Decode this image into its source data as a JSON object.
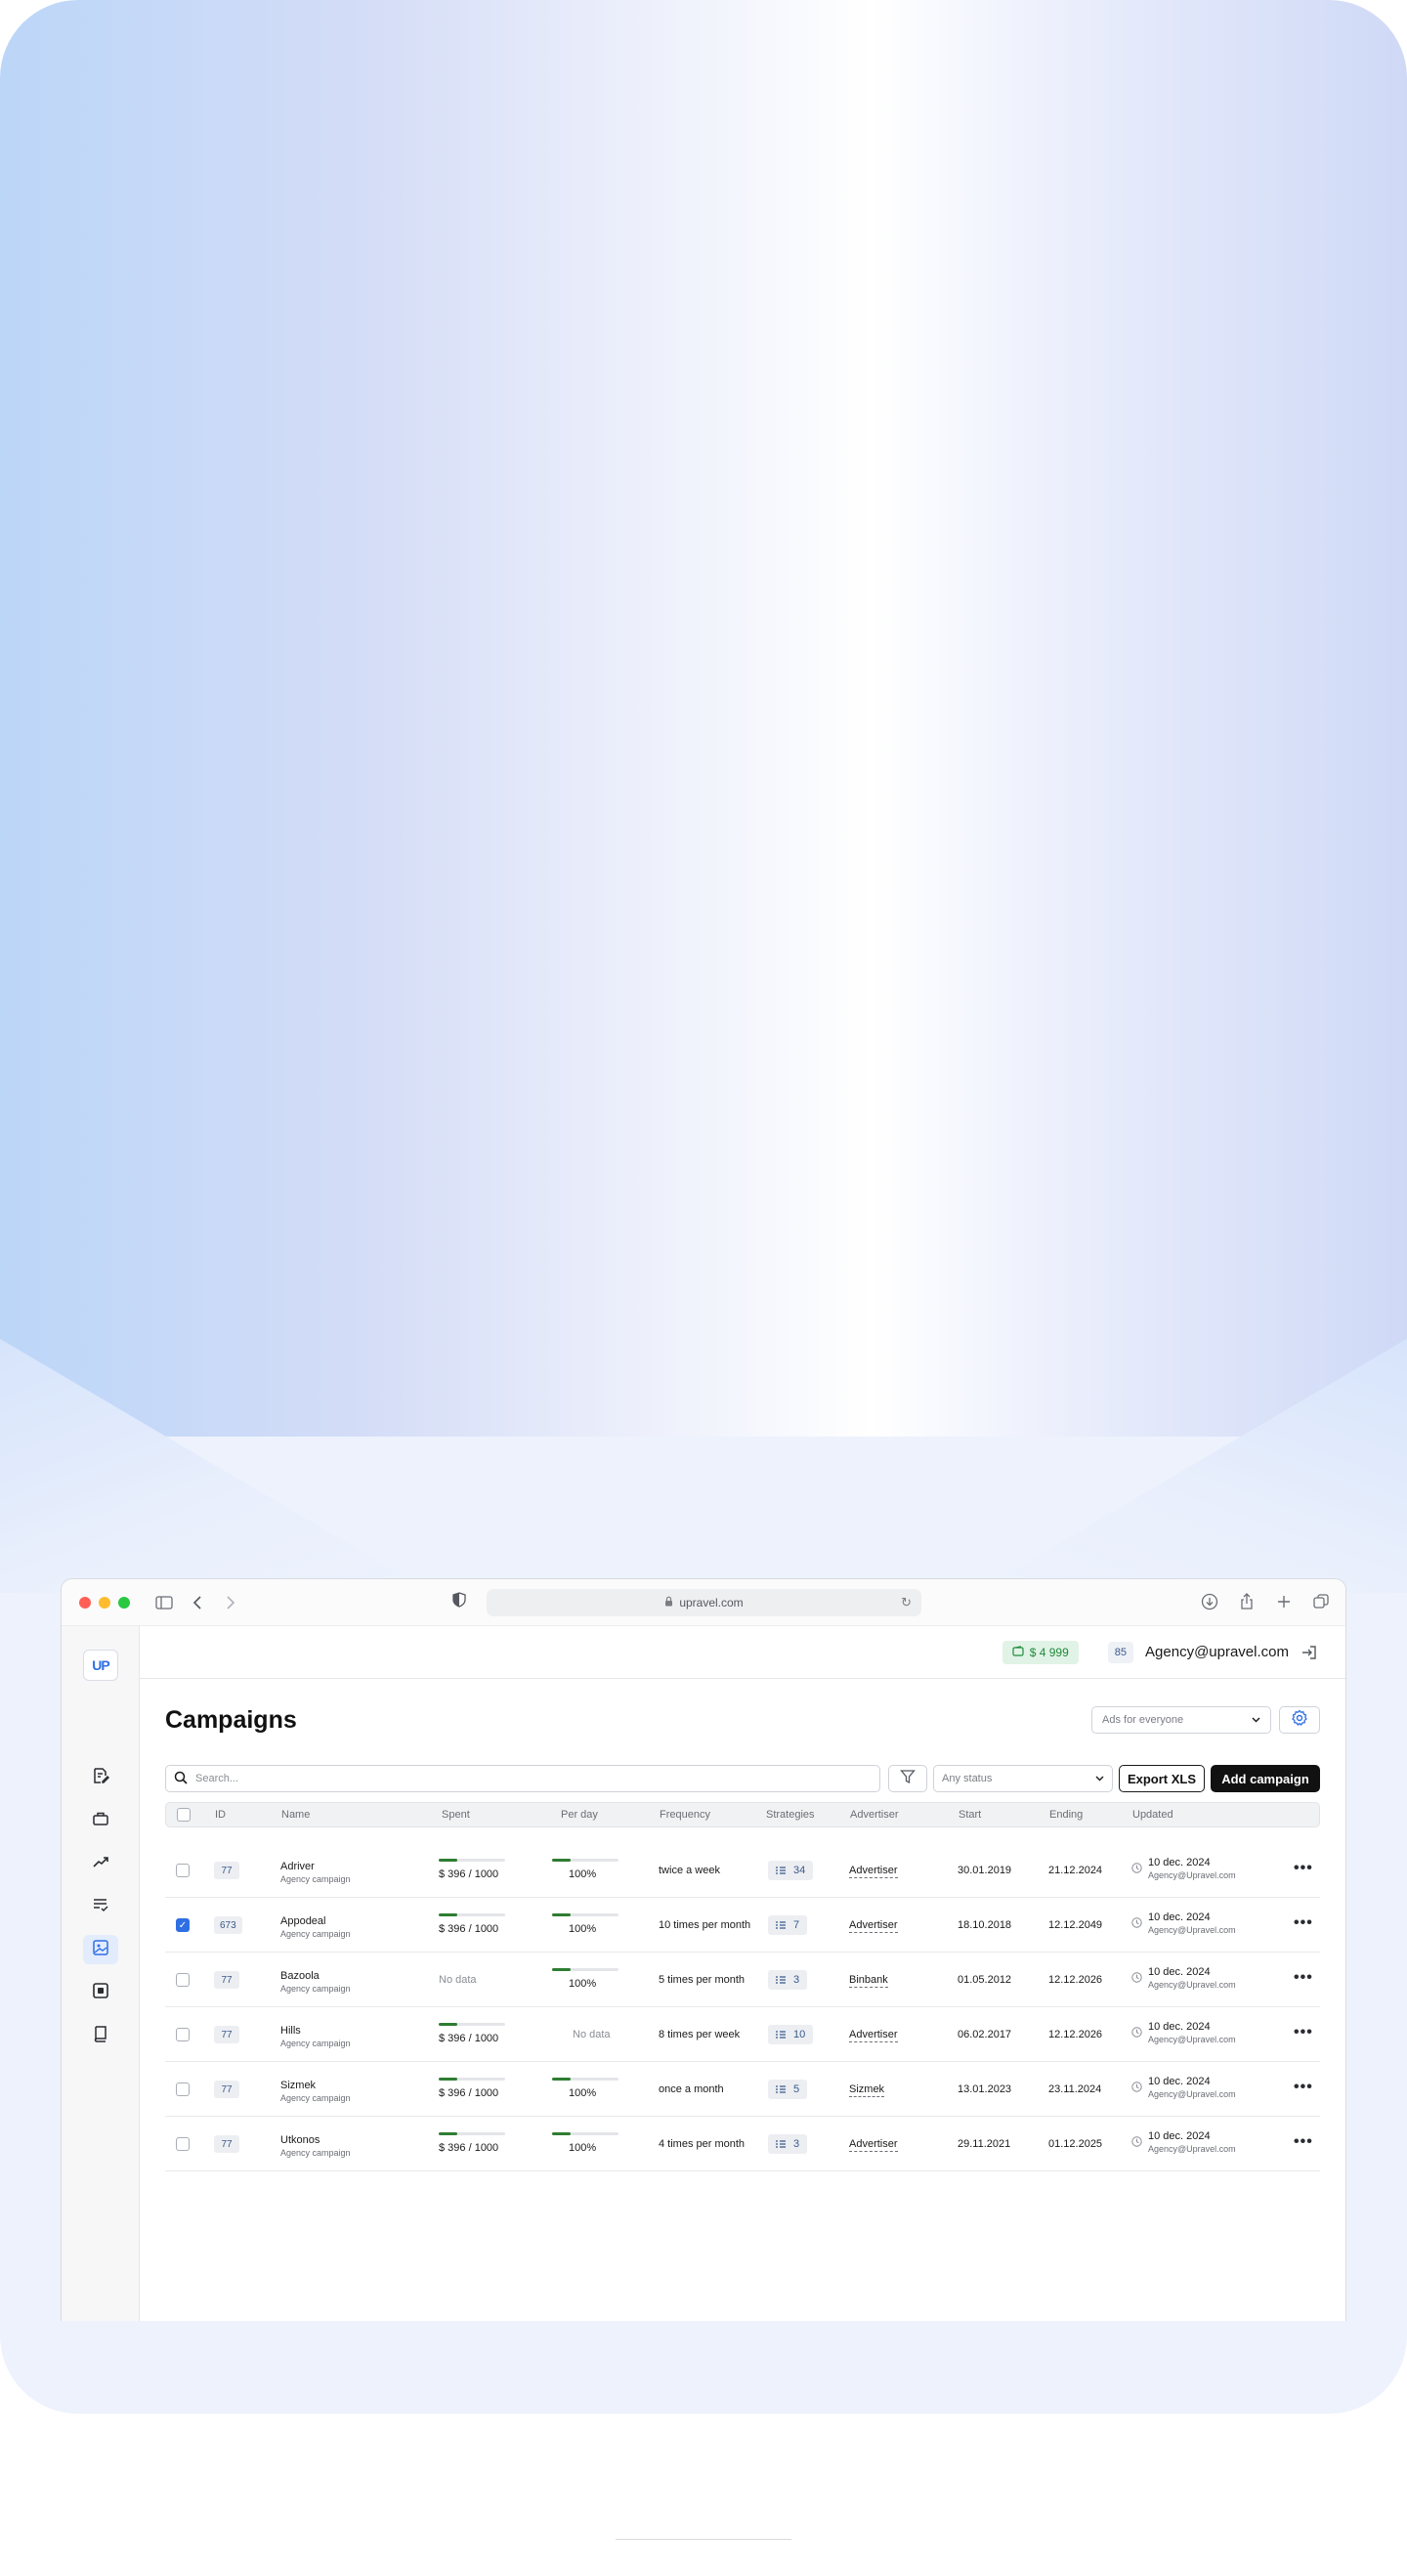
{
  "browser": {
    "url": "upravel.com"
  },
  "sidebar": {
    "logo_text": "UP",
    "items": [
      {
        "icon": "document-icon"
      },
      {
        "icon": "briefcase-icon"
      },
      {
        "icon": "trending-icon"
      },
      {
        "icon": "list-check-icon"
      },
      {
        "icon": "image-icon",
        "active": true
      },
      {
        "icon": "square-icon"
      },
      {
        "icon": "book-icon"
      }
    ]
  },
  "topbar": {
    "balance": "$ 4 999",
    "notifications": "85",
    "account": "Agency@upravel.com"
  },
  "page": {
    "title": "Campaigns",
    "ads_select": "Ads for everyone",
    "search_placeholder": "Search...",
    "status_select": "Any status",
    "export_label": "Export XLS",
    "add_label": "Add campaign"
  },
  "table": {
    "columns": [
      "ID",
      "Name",
      "Spent",
      "Per day",
      "Frequency",
      "Strategies",
      "Advertiser",
      "Start",
      "Ending",
      "Updated"
    ],
    "rows": [
      {
        "checked": false,
        "id": "77",
        "name": "Adriver",
        "sub": "Agency campaign",
        "spent": "$ 396 / 1000",
        "per_day": "100%",
        "frequency": "twice a week",
        "strategies": "34",
        "advertiser": "Advertiser",
        "start": "30.01.2019",
        "ending": "21.12.2024",
        "updated": "10 dec. 2024",
        "updated_by": "Agency@Upravel.com"
      },
      {
        "checked": true,
        "id": "673",
        "name": "Appodeal",
        "sub": "Agency campaign",
        "spent": "$ 396 / 1000",
        "per_day": "100%",
        "frequency": "10 times per month",
        "strategies": "7",
        "advertiser": "Advertiser",
        "start": "18.10.2018",
        "ending": "12.12.2049",
        "updated": "10 dec. 2024",
        "updated_by": "Agency@Upravel.com"
      },
      {
        "checked": false,
        "id": "77",
        "name": "Bazoola",
        "sub": "Agency campaign",
        "spent": "No data",
        "per_day": "100%",
        "frequency": "5 times per month",
        "strategies": "3",
        "advertiser": "Binbank",
        "start": "01.05.2012",
        "ending": "12.12.2026",
        "updated": "10 dec. 2024",
        "updated_by": "Agency@Upravel.com"
      },
      {
        "checked": false,
        "id": "77",
        "name": "Hills",
        "sub": "Agency campaign",
        "spent": "$ 396 / 1000",
        "per_day": "No data",
        "frequency": "8 times per week",
        "strategies": "10",
        "advertiser": "Advertiser",
        "start": "06.02.2017",
        "ending": "12.12.2026",
        "updated": "10 dec. 2024",
        "updated_by": "Agency@Upravel.com"
      },
      {
        "checked": false,
        "id": "77",
        "name": "Sizmek",
        "sub": "Agency campaign",
        "spent": "$ 396 / 1000",
        "per_day": "100%",
        "frequency": "once a month",
        "strategies": "5",
        "advertiser": "Sizmek",
        "start": "13.01.2023",
        "ending": "23.11.2024",
        "updated": "10 dec. 2024",
        "updated_by": "Agency@Upravel.com"
      },
      {
        "checked": false,
        "id": "77",
        "name": "Utkonos",
        "sub": "Agency campaign",
        "spent": "$ 396 / 1000",
        "per_day": "100%",
        "frequency": "4 times per month",
        "strategies": "3",
        "advertiser": "Advertiser",
        "start": "29.11.2021",
        "ending": "01.12.2025",
        "updated": "10 dec. 2024",
        "updated_by": "Agency@Upravel.com"
      }
    ]
  },
  "colors": {
    "accent": "#2f6fe4",
    "progress": "#2e7d32",
    "balance_bg": "#e1f3e6"
  }
}
